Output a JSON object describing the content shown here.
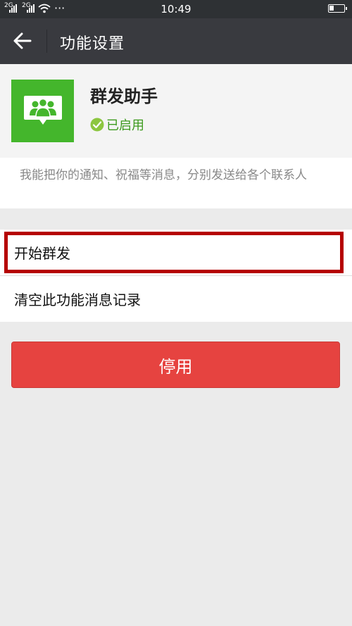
{
  "status_bar": {
    "signal1_label": "2G",
    "signal2_label": "2G",
    "dots": "···",
    "time": "10:49"
  },
  "header": {
    "title": "功能设置"
  },
  "plugin": {
    "name": "群发助手",
    "status": "已启用",
    "description": "我能把你的通知、祝福等消息，分别发送给各个联系人"
  },
  "menu": {
    "items": [
      {
        "label": "开始群发"
      },
      {
        "label": "清空此功能消息记录"
      }
    ]
  },
  "actions": {
    "disable_label": "停用"
  },
  "colors": {
    "status_bar_bg": "#2e3134",
    "nav_bg": "#393a3f",
    "icon_green": "#44b62c",
    "enabled_green": "#3c9a1d",
    "danger_red": "#e64340",
    "highlight_border": "#b50000",
    "page_bg": "#ebebeb"
  }
}
